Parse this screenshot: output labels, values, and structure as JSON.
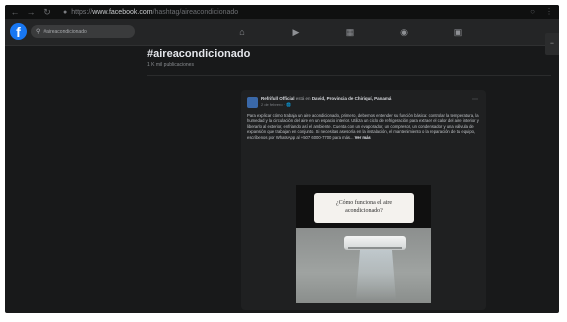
{
  "browser": {
    "url_host": "www.facebook.com",
    "url_scheme": "https://",
    "url_path": "/hashtag/aireacondicionado"
  },
  "fb": {
    "logo": "f",
    "search_value": "#aireacondicionado",
    "nav_icons": [
      "home-icon",
      "watch-icon",
      "marketplace-icon",
      "groups-icon",
      "gaming-icon"
    ]
  },
  "hashtag": {
    "title": "#aireacondicionado",
    "subtitle": "1 K mil publicaciones"
  },
  "post": {
    "author": "Refrifull Official",
    "connector": "está en",
    "location": "David, Provincia de Chiriquí, Panamá",
    "meta": "2 de febrero · 🌐",
    "text": "Para explicar cómo trabaja un aire acondicionado, primero, debemos entender su función básica: controlar la temperatura, la humedad y la circulación del aire en un espacio interior. Utiliza un ciclo de refrigeración para extraer el calor del aire interior y liberarlo al exterior, enfriando así el ambiente. Cuenta con un evaporador, un compresor, un condensador y una válvula de expansión que trabajan en conjunto. Si necesitas asesoría en la instalación, el mantenimiento o la reparación de tu equipo, escríbenos por WhatsApp al +507 6000-7700 para más...",
    "see_more": "Ver más",
    "image_caption_line1": "¿Cómo funciona el aire",
    "image_caption_line2": "acondicionado?"
  },
  "colors": {
    "background": "#18191a",
    "surface": "#242526",
    "brand": "#1877f2"
  }
}
